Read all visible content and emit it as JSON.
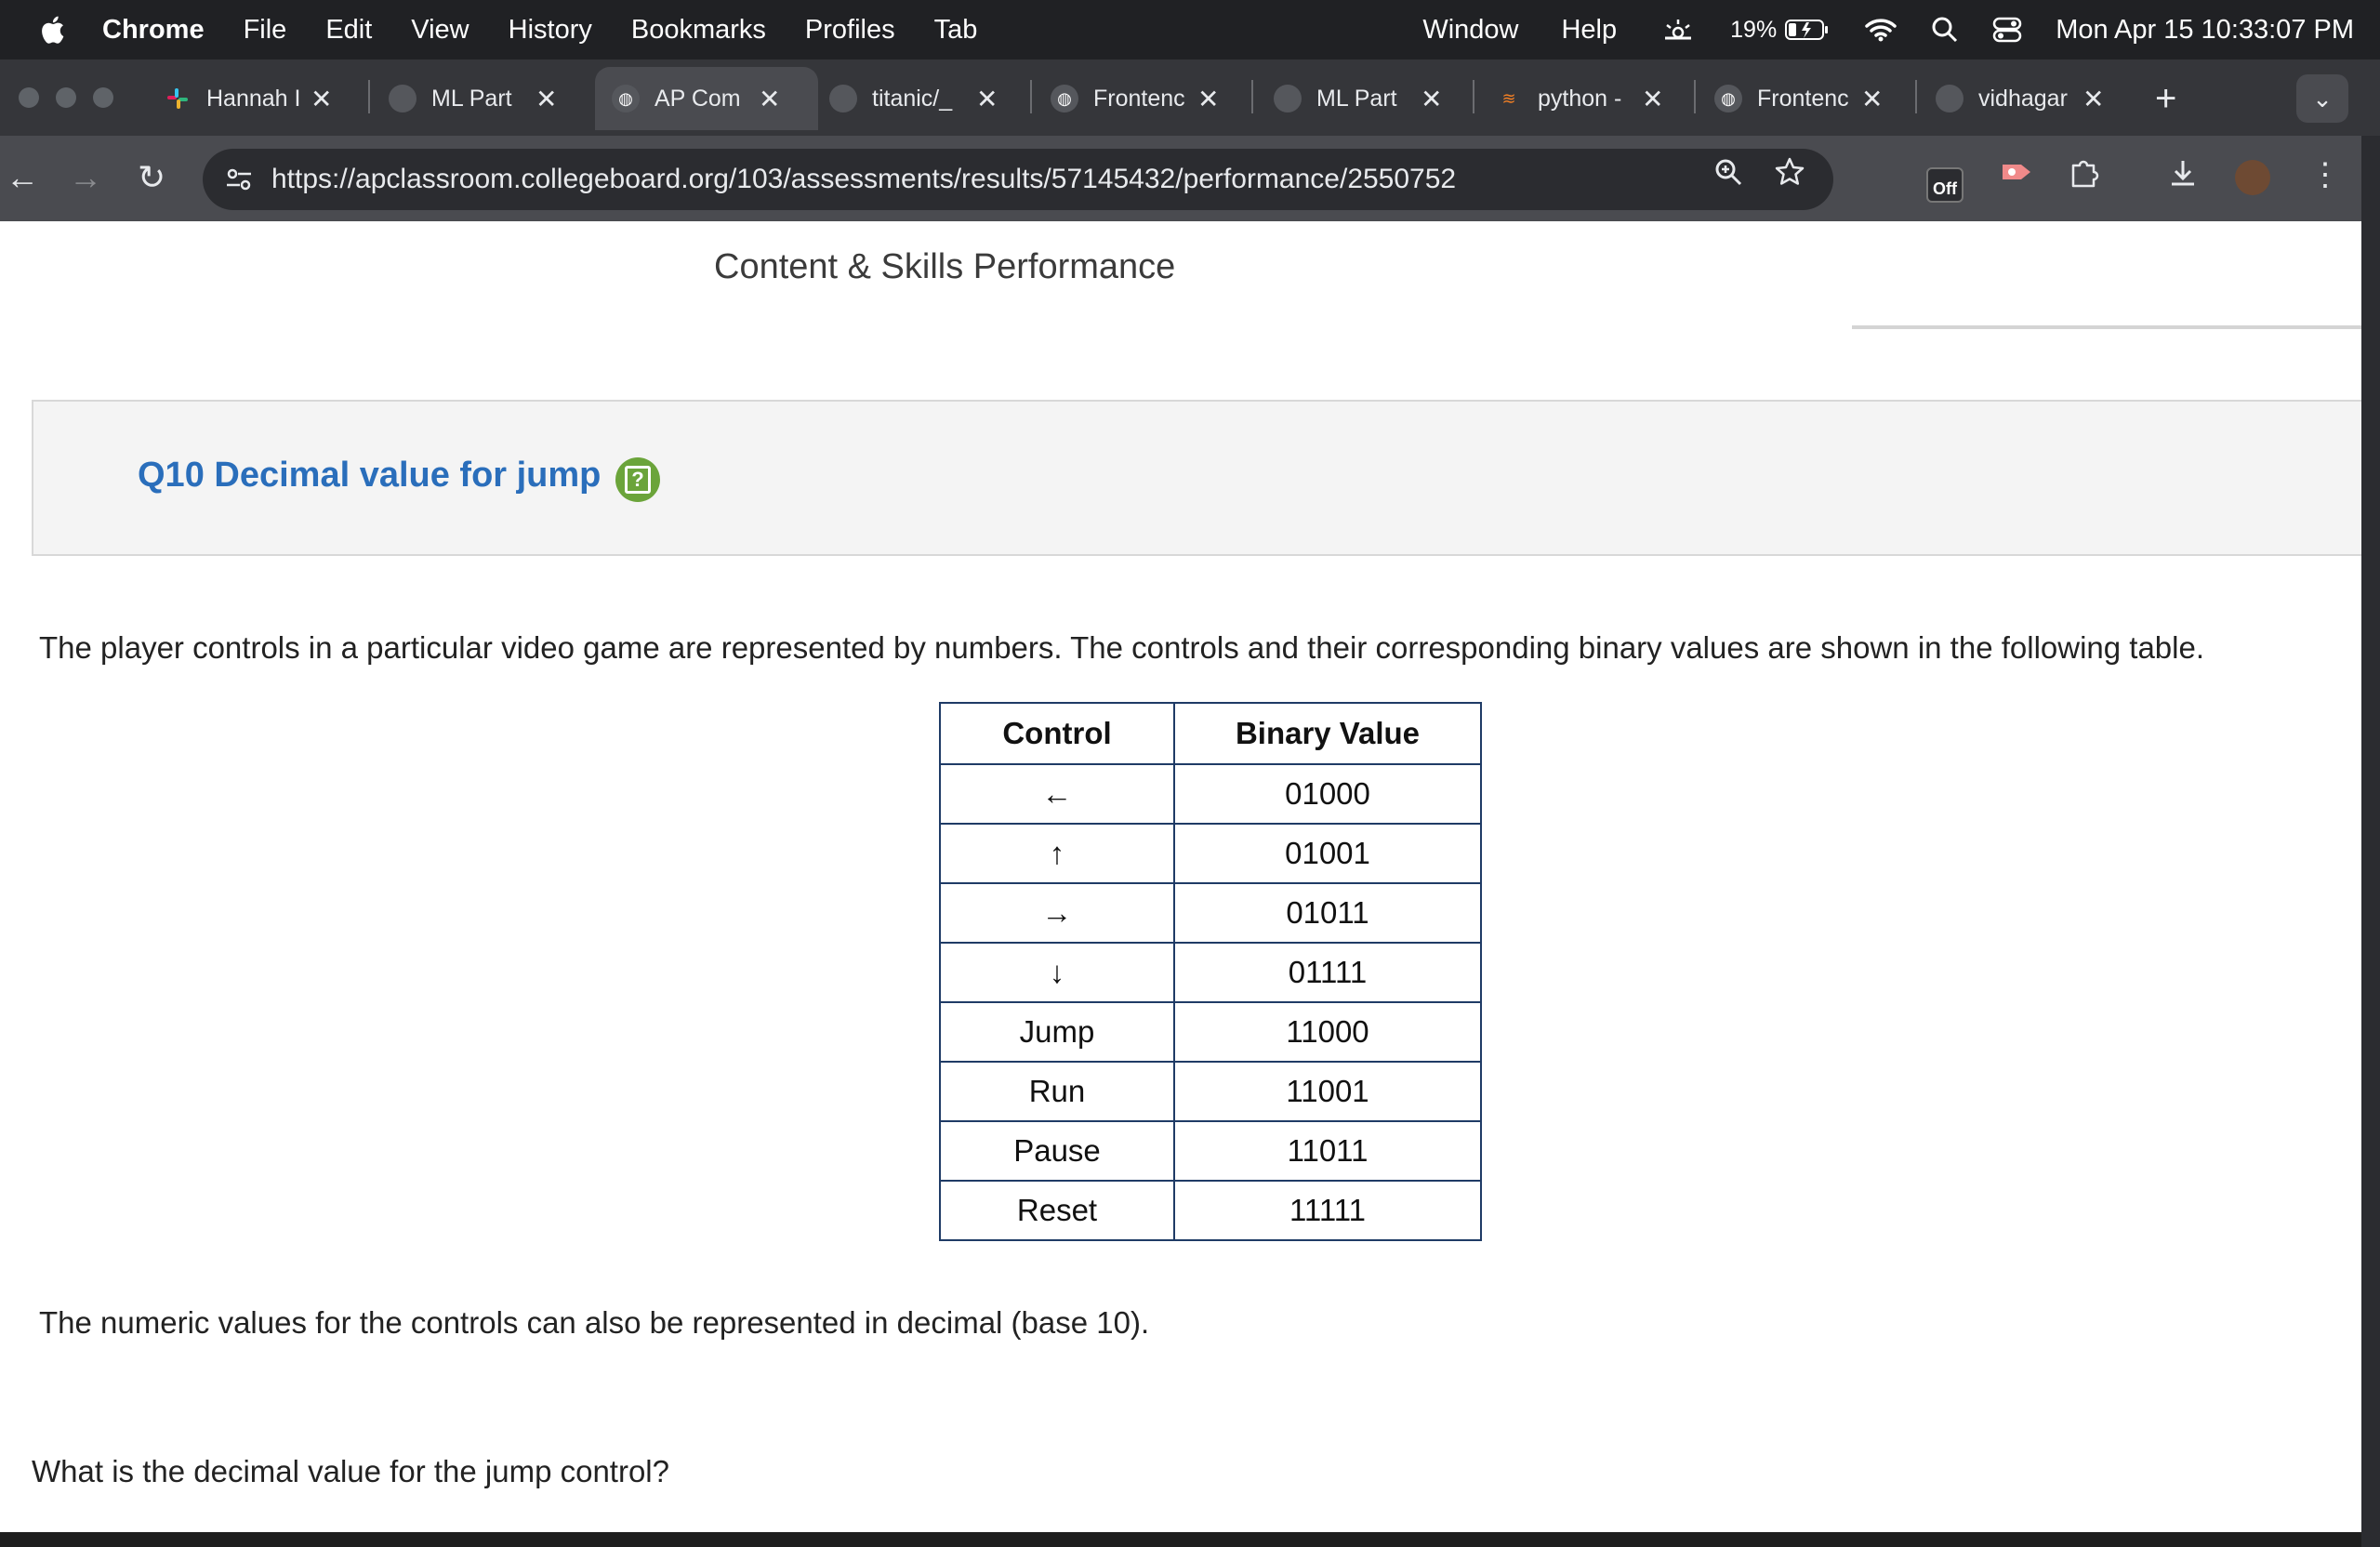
{
  "menubar": {
    "app_name": "Chrome",
    "menus": [
      "File",
      "Edit",
      "View",
      "History",
      "Bookmarks",
      "Profiles",
      "Tab"
    ],
    "right_menus": [
      "Window",
      "Help"
    ],
    "battery_percent": "19%",
    "clock": "Mon Apr 15  10:33:07 PM"
  },
  "tabs": [
    {
      "label": "Hannah I",
      "icon": "slack-icon"
    },
    {
      "label": "ML Part",
      "icon": "github-icon"
    },
    {
      "label": "AP Com",
      "icon": "globe-icon",
      "active": true
    },
    {
      "label": "titanic/_",
      "icon": "github-icon"
    },
    {
      "label": "Frontenc",
      "icon": "globe-icon"
    },
    {
      "label": "ML Part",
      "icon": "github-icon"
    },
    {
      "label": "python -",
      "icon": "stackoverflow-icon"
    },
    {
      "label": "Frontenc",
      "icon": "globe-icon"
    },
    {
      "label": "vidhagar",
      "icon": "github-icon"
    }
  ],
  "toolbar": {
    "url": "https://apclassroom.collegeboard.org/103/assessments/results/57145432/performance/2550752",
    "ext_off_label": "Off"
  },
  "page": {
    "title": "Content & Skills Performance",
    "question_title": "Q10 Decimal value for jump",
    "intro": "The player controls in a particular video game are represented by numbers. The controls and their corresponding binary values are shown in the following table.",
    "table": {
      "headers": [
        "Control",
        "Binary Value"
      ],
      "rows": [
        [
          "←",
          "01000"
        ],
        [
          "↑",
          "01001"
        ],
        [
          "→",
          "01011"
        ],
        [
          "↓",
          "01111"
        ],
        [
          "Jump",
          "11000"
        ],
        [
          "Run",
          "11001"
        ],
        [
          "Pause",
          "11011"
        ],
        [
          "Reset",
          "11111"
        ]
      ]
    },
    "note": "The numeric values for the controls can also be represented in decimal (base 10).",
    "question": "What is the decimal value for the jump control?"
  }
}
